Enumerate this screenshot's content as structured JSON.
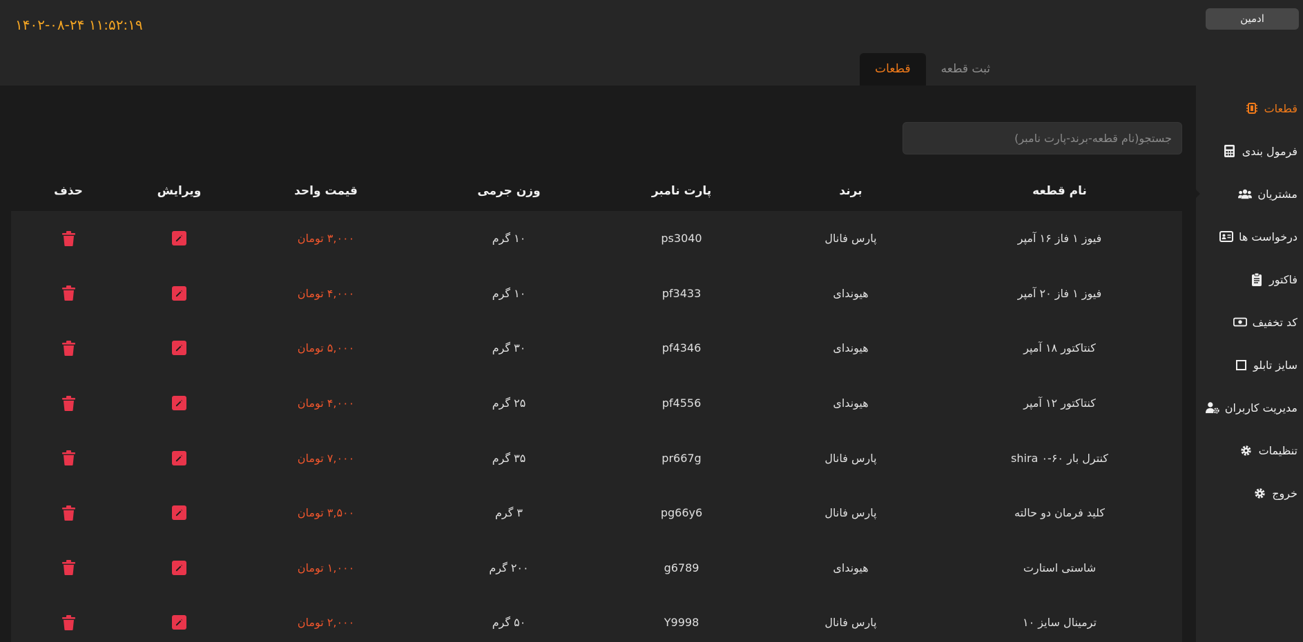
{
  "header": {
    "datetime": "۱۴۰۲-۰۸-۲۴ ۱۱:۵۲:۱۹",
    "user_label": "ادمین"
  },
  "tabs": [
    {
      "label": "ثبت قطعه",
      "active": false
    },
    {
      "label": "قطعات",
      "active": true
    }
  ],
  "search": {
    "placeholder": "جستجو(نام قطعه-برند-پارت نامبر)",
    "value": ""
  },
  "table": {
    "headers": {
      "name": "نام قطعه",
      "brand": "برند",
      "part": "پارت نامبر",
      "weight": "وزن جرمی",
      "price": "قیمت واحد",
      "edit": "ویرایش",
      "delete": "حذف"
    },
    "rows": [
      {
        "name": "فیوز ۱ فاز ۱۶ آمپر",
        "brand": "پارس فانال",
        "part": "ps3040",
        "weight": "۱۰ گرم",
        "price": "۳,۰۰۰ تومان"
      },
      {
        "name": "فیوز ۱ فاز ۲۰ آمپر",
        "brand": "هیوندای",
        "part": "pf3433",
        "weight": "۱۰ گرم",
        "price": "۴,۰۰۰ تومان"
      },
      {
        "name": "کنتاکتور ۱۸ آمپر",
        "brand": "هیوندای",
        "part": "pf4346",
        "weight": "۳۰ گرم",
        "price": "۵,۰۰۰ تومان"
      },
      {
        "name": "کنتاکتور ۱۲ آمپر",
        "brand": "هیوندای",
        "part": "pf4556",
        "weight": "۲۵ گرم",
        "price": "۴,۰۰۰ تومان"
      },
      {
        "name": "کنترل بار ۶۰-۰ shira",
        "brand": "پارس فانال",
        "part": "pr667g",
        "weight": "۳۵ گرم",
        "price": "۷,۰۰۰ تومان"
      },
      {
        "name": "کلید فرمان دو حالته",
        "brand": "پارس فانال",
        "part": "pg66y6",
        "weight": "۳ گرم",
        "price": "۳,۵۰۰ تومان"
      },
      {
        "name": "شاستی استارت",
        "brand": "هیوندای",
        "part": "g6789",
        "weight": "۲۰۰ گرم",
        "price": "۱,۰۰۰ تومان"
      },
      {
        "name": "ترمینال سایز ۱۰",
        "brand": "پارس فانال",
        "part": "Y9998",
        "weight": "۵۰ گرم",
        "price": "۲,۰۰۰ تومان"
      }
    ]
  },
  "sidebar": {
    "items": [
      {
        "label": "قطعات",
        "icon": "chip-icon",
        "active": true
      },
      {
        "label": "فرمول بندی",
        "icon": "calculator-icon",
        "active": false
      },
      {
        "label": "مشتریان",
        "icon": "users-icon",
        "active": false
      },
      {
        "label": "درخواست ها",
        "icon": "id-card-icon",
        "active": false
      },
      {
        "label": "فاکتور",
        "icon": "clipboard-icon",
        "active": false
      },
      {
        "label": "کد تخفیف",
        "icon": "money-icon",
        "active": false
      },
      {
        "label": "سایز تابلو",
        "icon": "square-icon",
        "active": false
      },
      {
        "label": "مدیریت کاربران",
        "icon": "user-gear-icon",
        "active": false
      },
      {
        "label": "تنظیمات",
        "icon": "gear-icon",
        "active": false
      },
      {
        "label": "خروج",
        "icon": "gear-icon",
        "active": false
      }
    ]
  },
  "colors": {
    "accent": "#f07a1a",
    "datetime": "#f5a623",
    "price": "#f0562c",
    "danger": "#e9354b"
  }
}
